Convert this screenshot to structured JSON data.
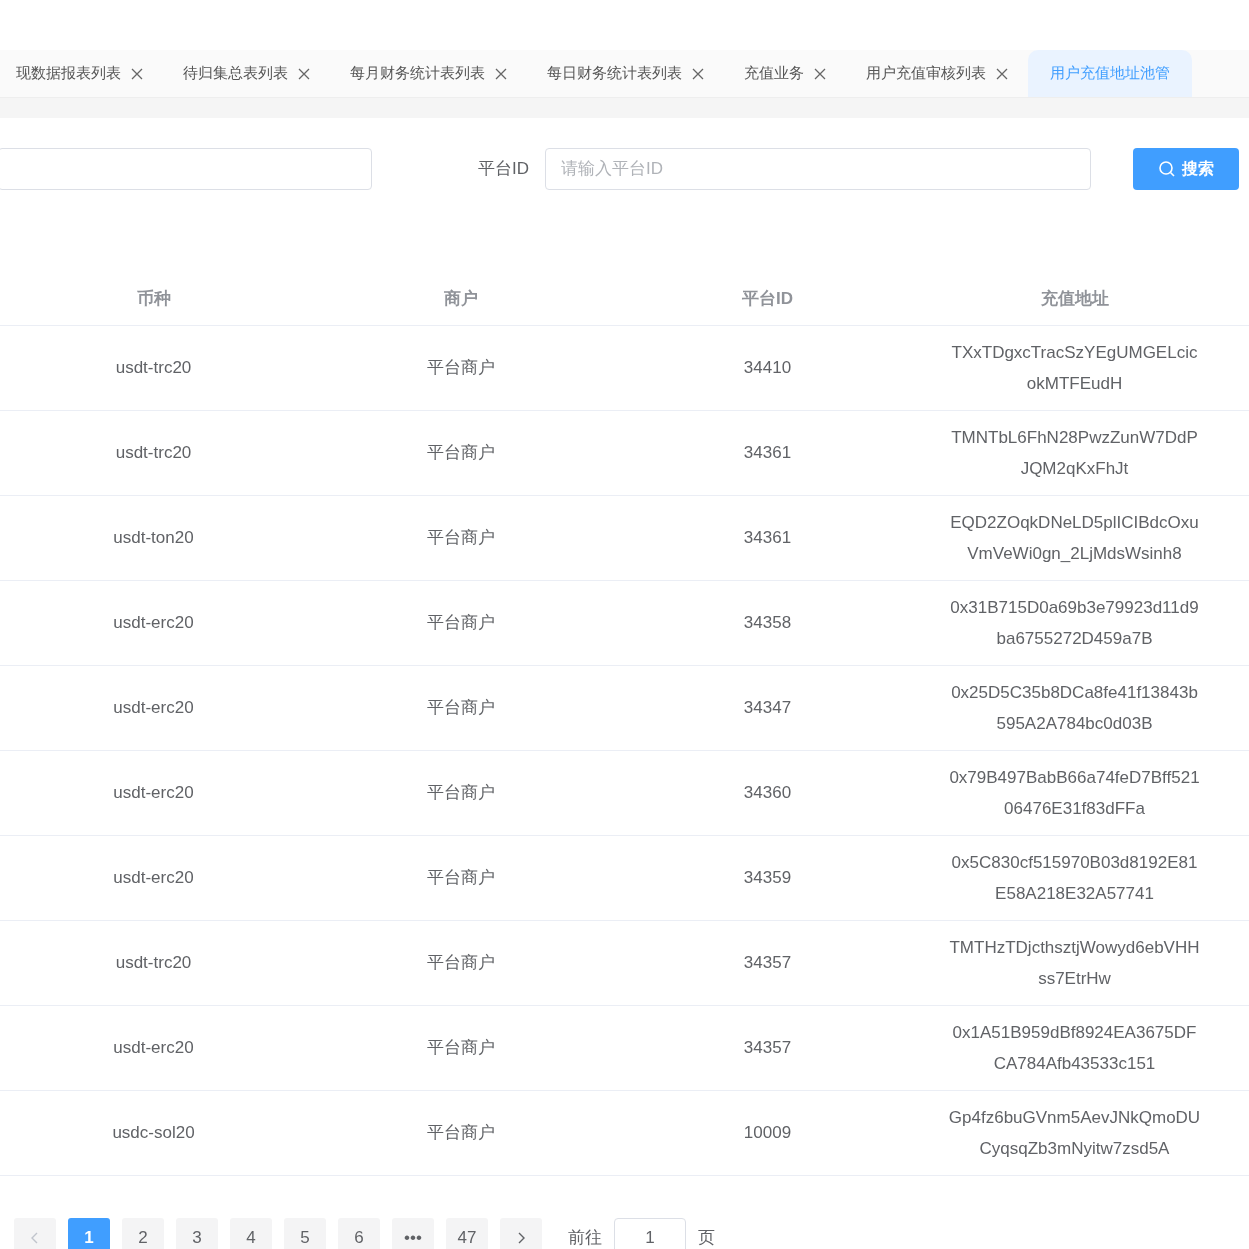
{
  "tabs": [
    {
      "label": "现数据报表列表",
      "selected": false,
      "closable": true
    },
    {
      "label": "待归集总表列表",
      "selected": false,
      "closable": true
    },
    {
      "label": "每月财务统计表列表",
      "selected": false,
      "closable": true
    },
    {
      "label": "每日财务统计表列表",
      "selected": false,
      "closable": true
    },
    {
      "label": "充值业务",
      "selected": false,
      "closable": true
    },
    {
      "label": "用户充值审核列表",
      "selected": false,
      "closable": true
    },
    {
      "label": "用户充值地址池管",
      "selected": true,
      "closable": false
    }
  ],
  "filters": {
    "platform_id_label": "平台ID",
    "platform_id_placeholder": "请输入平台ID",
    "search_button": "搜索"
  },
  "table": {
    "columns": [
      "币种",
      "商户",
      "平台ID",
      "充值地址"
    ],
    "rows": [
      [
        "usdt-trc20",
        "平台商户",
        "34410",
        "TXxTDgxcTracSzYEgUMGELcicokMTFEudH"
      ],
      [
        "usdt-trc20",
        "平台商户",
        "34361",
        "TMNTbL6FhN28PwzZunW7DdPJQM2qKxFhJt"
      ],
      [
        "usdt-ton20",
        "平台商户",
        "34361",
        "EQD2ZOqkDNeLD5plICIBdcOxuVmVeWi0gn_2LjMdsWsinh8"
      ],
      [
        "usdt-erc20",
        "平台商户",
        "34358",
        "0x31B715D0a69b3e79923d11d9ba6755272D459a7B"
      ],
      [
        "usdt-erc20",
        "平台商户",
        "34347",
        "0x25D5C35b8DCa8fe41f13843b595A2A784bc0d03B"
      ],
      [
        "usdt-erc20",
        "平台商户",
        "34360",
        "0x79B497BabB66a74feD7Bff52106476E31f83dFFa"
      ],
      [
        "usdt-erc20",
        "平台商户",
        "34359",
        "0x5C830cf515970B03d8192E81E58A218E32A57741"
      ],
      [
        "usdt-trc20",
        "平台商户",
        "34357",
        "TMTHzTDjcthsztjWowyd6ebVHHss7EtrHw"
      ],
      [
        "usdt-erc20",
        "平台商户",
        "34357",
        "0x1A51B959dBf8924EA3675DFCA784Afb43533c151"
      ],
      [
        "usdc-sol20",
        "平台商户",
        "10009",
        "Gp4fz6buGVnm5AevJNkQmoDUCyqsqZb3mNyitw7zsd5A"
      ]
    ]
  },
  "pagination": {
    "pages": [
      {
        "label": "1",
        "selected": true
      },
      {
        "label": "2",
        "selected": false
      },
      {
        "label": "3",
        "selected": false
      },
      {
        "label": "4",
        "selected": false
      },
      {
        "label": "5",
        "selected": false
      },
      {
        "label": "6",
        "selected": false
      },
      {
        "label": "•••",
        "selected": false
      },
      {
        "label": "47",
        "selected": false
      }
    ],
    "goto_label": "前往",
    "goto_value": "1",
    "page_unit": "页"
  }
}
